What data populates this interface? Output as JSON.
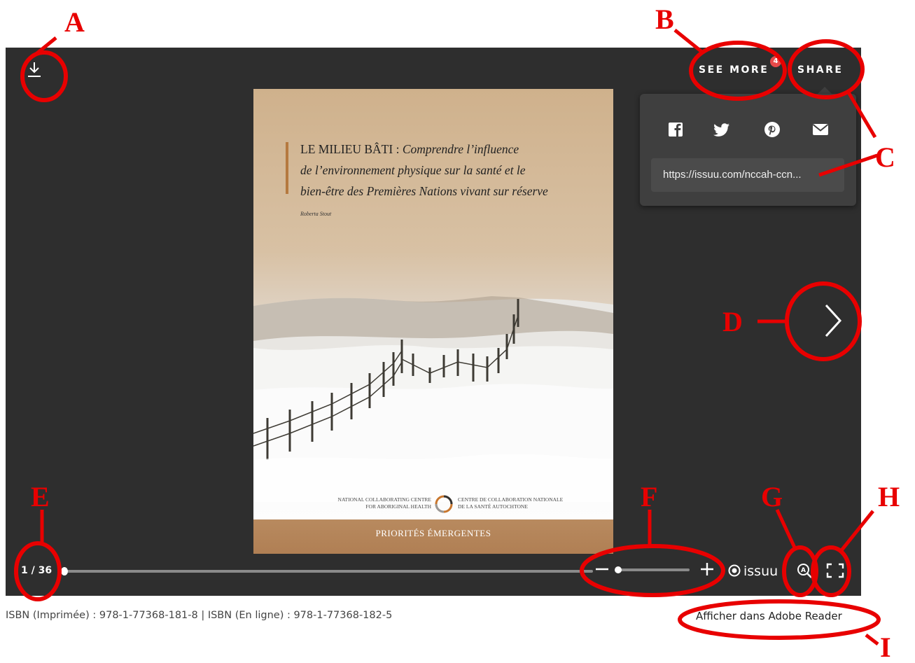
{
  "toolbar": {
    "see_more_label": "SEE MORE",
    "see_more_badge": "4",
    "share_label": "SHARE"
  },
  "share_popup": {
    "social_icons": [
      "facebook-icon",
      "twitter-icon",
      "pinterest-icon",
      "email-icon"
    ],
    "url": "https://issuu.com/nccah-ccn..."
  },
  "cover": {
    "title_caps": "LE MILIEU BÂTI : ",
    "title_italic_1": "Comprendre l’influence",
    "title_line_2": "de l’environnement physique sur la santé et le",
    "title_line_3": "bien-être des Premières Nations vivant sur réserve",
    "author": "Roberta Stout",
    "org_left_1": "NATIONAL COLLABORATING CENTRE",
    "org_left_2": "FOR ABORIGINAL HEALTH",
    "org_right_1": "CENTRE DE COLLABORATION NATIONALE",
    "org_right_2": "DE LA SANTÉ AUTOCHTONE",
    "footer": "PRIORITÉS ÉMERGENTES"
  },
  "bottom_bar": {
    "page_counter": "1 / 36",
    "current_page": 1,
    "total_pages": 36,
    "brand": "issuu"
  },
  "footer": {
    "isbn": "ISBN (Imprimée) : 978-1-77368-181-8 | ISBN (En ligne) : 978-1-77368-182-5",
    "adobe_link": "Afficher dans Adobe Reader"
  },
  "annotations": {
    "labels": [
      "A",
      "B",
      "C",
      "D",
      "E",
      "F",
      "G",
      "H",
      "I"
    ],
    "color": "#e80000"
  },
  "colors": {
    "viewer_bg": "#2e2e2e",
    "popup_bg": "#3f3f3f",
    "badge": "#e84a4a",
    "cover_footer": "#b07f54"
  }
}
